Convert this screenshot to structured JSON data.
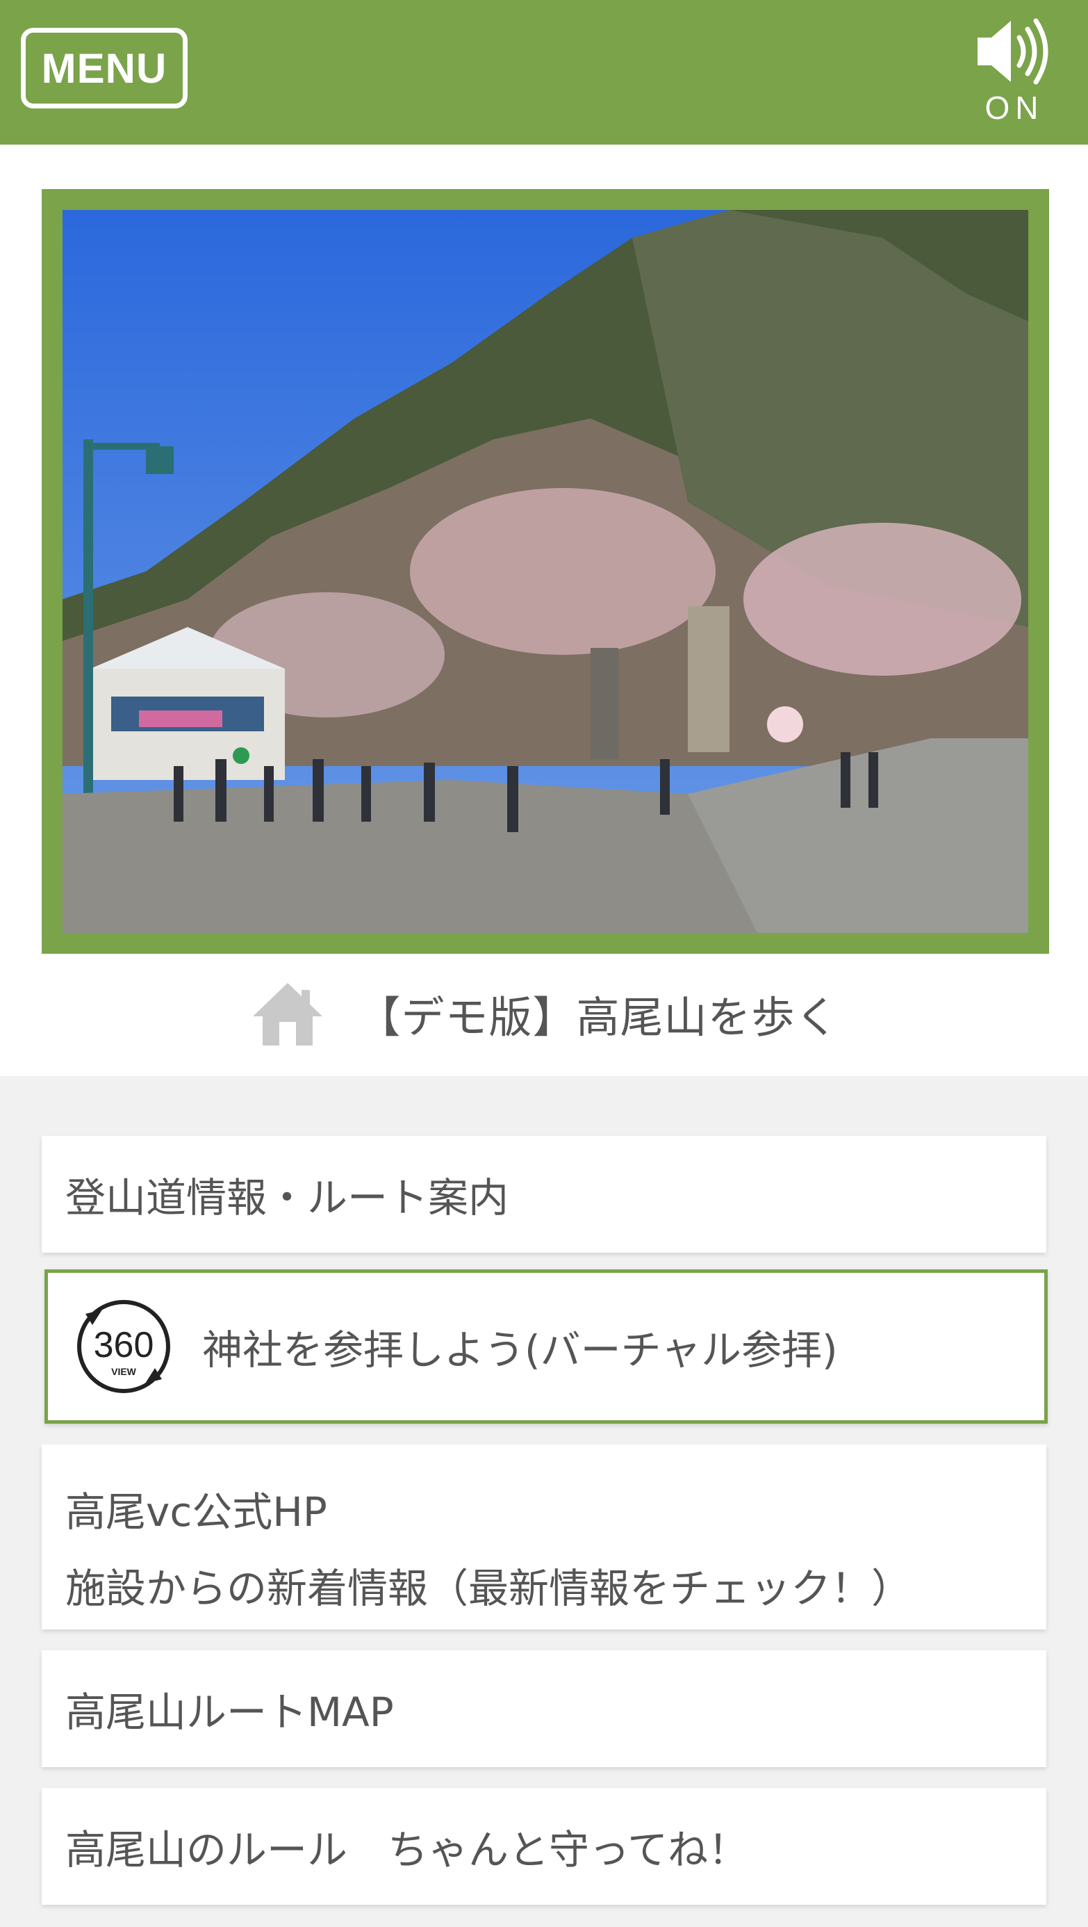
{
  "header": {
    "menu_label": "MENU",
    "sound_state": "ON",
    "sound_icon": "speaker-icon",
    "bg_color": "#7aa34a"
  },
  "hero": {
    "image": "photo-takaosan-entrance",
    "title_icon": "home-icon",
    "title": "【デモ版】高尾山を歩く"
  },
  "menu_items": [
    {
      "label": "登山道情報・ルート案内"
    },
    {
      "label": "神社を参拝しよう(バーチャル参拝)",
      "icon": "360-view-icon",
      "icon_text": "360",
      "icon_subtext": "VIEW",
      "highlighted": true
    },
    {
      "line1": "高尾vc公式HP",
      "line2": "施設からの新着情報（最新情報をチェック！）"
    },
    {
      "label": "高尾山ルートMAP"
    },
    {
      "label": "高尾山のルール　ちゃんと守ってね！"
    }
  ],
  "colors": {
    "accent": "#7aa34a",
    "text": "#555555",
    "panel_bg": "#f1f1f1"
  }
}
